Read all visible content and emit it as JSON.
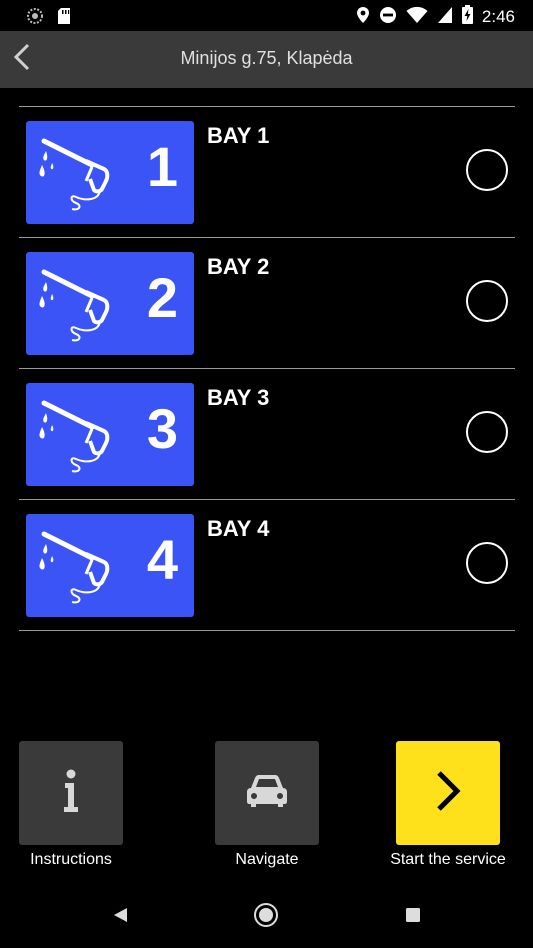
{
  "status_bar": {
    "time": "2:46",
    "icons": [
      "app-notification-icon",
      "sd-card-icon",
      "location-icon",
      "do-not-disturb-icon",
      "wifi-icon",
      "signal-icon",
      "battery-charging-icon"
    ]
  },
  "header": {
    "title": "Minijos g.75, Klapėda",
    "back_icon": "chevron-left-icon"
  },
  "bays": [
    {
      "number": "1",
      "name": "BAY 1",
      "selected": false
    },
    {
      "number": "2",
      "name": "BAY 2",
      "selected": false
    },
    {
      "number": "3",
      "name": "BAY 3",
      "selected": false
    },
    {
      "number": "4",
      "name": "BAY 4",
      "selected": false
    }
  ],
  "actions": {
    "instructions": {
      "label": "Instructions",
      "icon": "info-icon"
    },
    "navigate": {
      "label": "Navigate",
      "icon": "car-icon"
    },
    "start": {
      "label": "Start the service",
      "icon": "chevron-right-icon"
    }
  },
  "colors": {
    "tile_blue": "#3b54f5",
    "header_gray": "#3a3a3a",
    "accent_yellow": "#ffe11b"
  },
  "nav_bar": {
    "icons": [
      "back-triangle-icon",
      "home-circle-icon",
      "recents-square-icon"
    ]
  }
}
